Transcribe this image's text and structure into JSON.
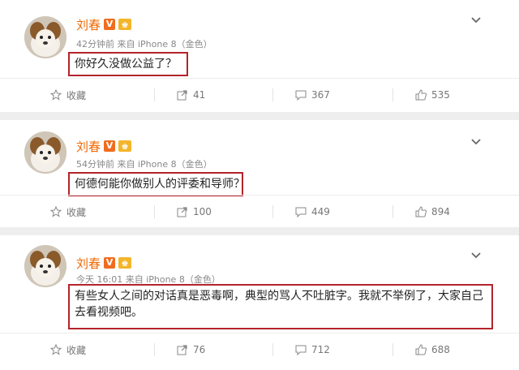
{
  "posts": [
    {
      "author": "刘春",
      "verified_badge": "V",
      "meta": "42分钟前 来自 iPhone 8（金色）",
      "content": "你好久没做公益了？",
      "actions": {
        "favorite": "收藏",
        "repost": "41",
        "comment": "367",
        "like": "535"
      }
    },
    {
      "author": "刘春",
      "verified_badge": "V",
      "meta": "54分钟前 来自 iPhone 8（金色）",
      "content": "何德何能你做别人的评委和导师？",
      "actions": {
        "favorite": "收藏",
        "repost": "100",
        "comment": "449",
        "like": "894"
      }
    },
    {
      "author": "刘春",
      "verified_badge": "V",
      "meta": "今天 16:01 来自 iPhone 8（金色）",
      "content": "有些女人之间的对话真是恶毒啊，典型的骂人不吐脏字。我就不举例了，大家自己去看视频吧。",
      "actions": {
        "favorite": "收藏",
        "repost": "76",
        "comment": "712",
        "like": "688"
      }
    }
  ],
  "colors": {
    "name": "#f06800",
    "highlight_border": "#b4242b",
    "badge": "#f06d1f"
  }
}
